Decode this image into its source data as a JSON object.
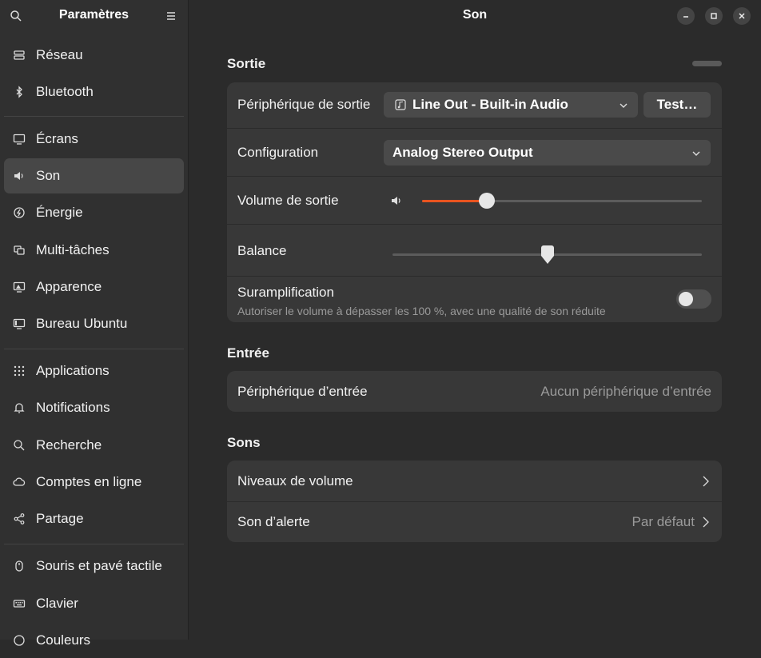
{
  "sidebar": {
    "title": "Paramètres",
    "groups": [
      {
        "items": [
          {
            "label": "Réseau",
            "icon": "network-icon"
          },
          {
            "label": "Bluetooth",
            "icon": "bluetooth-icon"
          }
        ]
      },
      {
        "items": [
          {
            "label": "Écrans",
            "icon": "display-icon"
          },
          {
            "label": "Son",
            "icon": "speaker-icon",
            "active": true
          },
          {
            "label": "Énergie",
            "icon": "power-icon"
          },
          {
            "label": "Multi-tâches",
            "icon": "multitasking-icon"
          },
          {
            "label": "Apparence",
            "icon": "appearance-icon"
          },
          {
            "label": "Bureau Ubuntu",
            "icon": "ubuntu-desktop-icon"
          }
        ]
      },
      {
        "items": [
          {
            "label": "Applications",
            "icon": "apps-grid-icon"
          },
          {
            "label": "Notifications",
            "icon": "bell-icon"
          },
          {
            "label": "Recherche",
            "icon": "search-icon"
          },
          {
            "label": "Comptes en ligne",
            "icon": "cloud-icon"
          },
          {
            "label": "Partage",
            "icon": "share-icon"
          }
        ]
      },
      {
        "items": [
          {
            "label": "Souris et pavé tactile",
            "icon": "mouse-icon"
          },
          {
            "label": "Clavier",
            "icon": "keyboard-icon"
          },
          {
            "label": "Couleurs",
            "icon": "color-icon"
          }
        ]
      }
    ]
  },
  "header": {
    "title": "Son"
  },
  "sortie": {
    "title": "Sortie",
    "device_label": "Périphérique de sortie",
    "device_value": "Line Out - Built-in Audio",
    "test_label": "Test…",
    "config_label": "Configuration",
    "config_value": "Analog Stereo Output",
    "volume_label": "Volume de sortie",
    "volume_level": 0.23,
    "balance_label": "Balance",
    "balance_level": 0.5,
    "overamp_label": "Suramplification",
    "overamp_desc": "Autoriser le volume à dépasser les 100 %, avec une qualité de son réduite",
    "overamp_on": false
  },
  "entree": {
    "title": "Entrée",
    "device_label": "Périphérique d’entrée",
    "device_value": "Aucun périphérique d’entrée"
  },
  "sons": {
    "title": "Sons",
    "volume_levels_label": "Niveaux de volume",
    "alert_label": "Son d’alerte",
    "alert_value": "Par défaut"
  },
  "colors": {
    "accent": "#e95420"
  }
}
